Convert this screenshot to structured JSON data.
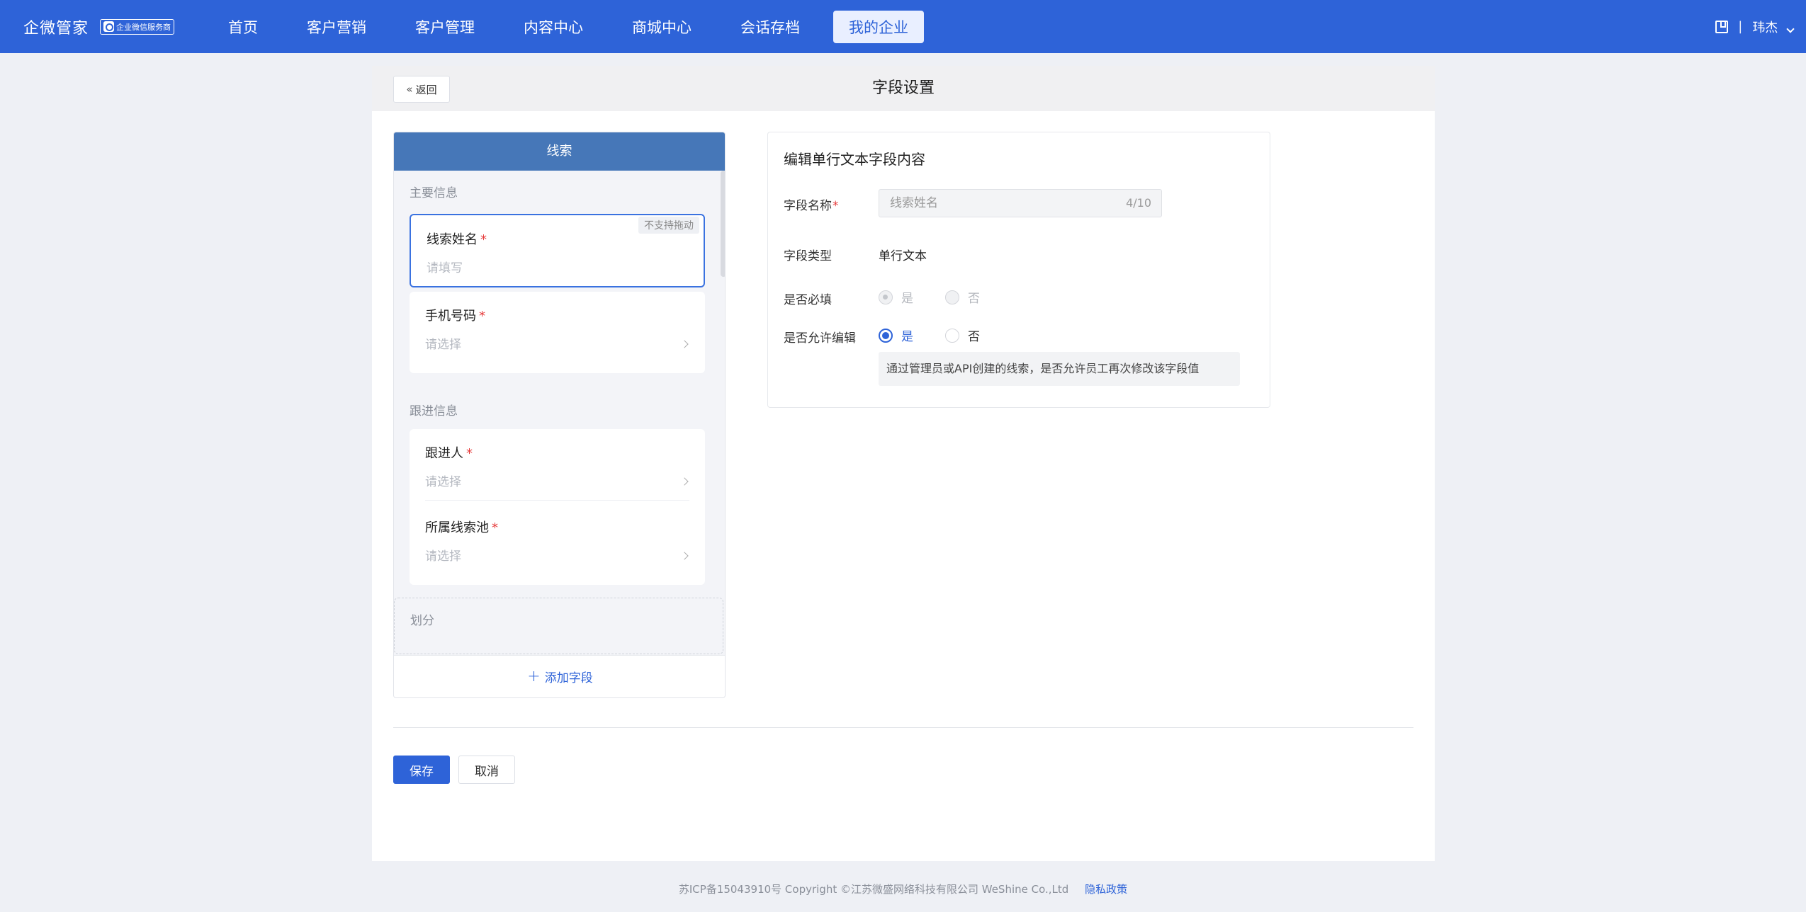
{
  "brand": {
    "name": "企微管家",
    "badge": "企业微信服务商"
  },
  "nav": {
    "items": [
      {
        "label": "首页"
      },
      {
        "label": "客户营销"
      },
      {
        "label": "客户管理"
      },
      {
        "label": "内容中心"
      },
      {
        "label": "商城中心"
      },
      {
        "label": "会话存档"
      },
      {
        "label": "我的企业",
        "active": true
      }
    ],
    "separator": "|",
    "user": "玮杰"
  },
  "page": {
    "back_label": "返回",
    "title": "字段设置"
  },
  "left_panel": {
    "title": "线索",
    "sections": [
      {
        "title": "主要信息",
        "fields": [
          {
            "label": "线索姓名",
            "placeholder": "请填写",
            "required": "*",
            "tag": "不支持拖动"
          },
          {
            "label": "手机号码",
            "placeholder": "请选择",
            "required": "*"
          }
        ]
      },
      {
        "title": "跟进信息",
        "fields": [
          {
            "label": "跟进人",
            "placeholder": "请选择",
            "required": "*"
          },
          {
            "label": "所属线索池",
            "placeholder": "请选择",
            "required": "*"
          }
        ]
      },
      {
        "title": "划分"
      }
    ],
    "add_field_label": "添加字段"
  },
  "editor": {
    "title": "编辑单行文本字段内容",
    "name_label": "字段名称",
    "name_required": "*",
    "name_value": "线索姓名",
    "name_count": "4/10",
    "type_label": "字段类型",
    "type_value": "单行文本",
    "required_label": "是否必填",
    "required_options": {
      "yes": "是",
      "no": "否"
    },
    "editable_label": "是否允许编辑",
    "editable_options": {
      "yes": "是",
      "no": "否"
    },
    "hint": "通过管理员或API创建的线索，是否允许员工再次修改该字段值"
  },
  "actions": {
    "save": "保存",
    "cancel": "取消"
  },
  "footer": {
    "text": "苏ICP备15043910号 Copyright ©江苏微盛网络科技有限公司 WeShine Co.,Ltd",
    "privacy": "隐私政策"
  },
  "colors": {
    "primary": "#2e63d8",
    "panel_header": "#4677b8",
    "required": "#e63b3b"
  }
}
